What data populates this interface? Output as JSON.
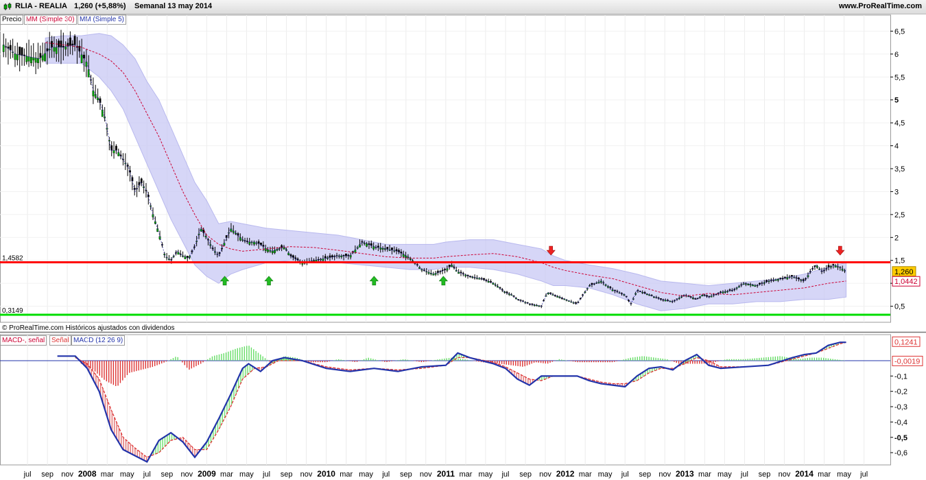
{
  "header": {
    "ticker": "RLIA - REALIA",
    "price_change": "1,260 (+5,88%)",
    "period": "Semanal  13 may 2014",
    "site": "www.ProRealTime.com"
  },
  "legend": {
    "price": "Precio",
    "ma30": "MM (Simple 30)",
    "ma5": "MM (Simple 5)",
    "macd_signal": "MACD-, señal",
    "signal": "Señal",
    "macd": "MACD (12 26 9)"
  },
  "footer_note": "© ProRealTime.com Históricos ajustados con dividendos",
  "colors": {
    "resistance": "#ff0000",
    "support": "#00dd00",
    "ma30": "#cc0033",
    "ma5": "#3333aa",
    "band": "#c8c8f4",
    "macd_line": "#2233aa",
    "hist_pos": "#66dd66",
    "hist_neg": "#dd3333",
    "arrow_up": "#22bb22",
    "arrow_down": "#ee2222"
  },
  "chart_data": [
    {
      "type": "line",
      "name": "price-panel",
      "ylim": [
        0.15,
        6.85
      ],
      "y_ticks": [
        "6,5",
        "6",
        "5,5",
        "5",
        "4,5",
        "4",
        "3,5",
        "3",
        "2,5",
        "2",
        "1,5",
        "1",
        "0,5"
      ],
      "y_tick_values": [
        6.5,
        6,
        5.5,
        5,
        4.5,
        4,
        3.5,
        3,
        2.5,
        2,
        1.5,
        1,
        0.5
      ],
      "x_months": [
        "jul",
        "sep",
        "nov",
        "2008",
        "mar",
        "may",
        "jul",
        "sep",
        "nov",
        "2009",
        "mar",
        "may",
        "jul",
        "sep",
        "nov",
        "2010",
        "mar",
        "may",
        "jul",
        "sep",
        "nov",
        "2011",
        "mar",
        "may",
        "jul",
        "sep",
        "nov",
        "2012",
        "mar",
        "may",
        "jul",
        "sep",
        "nov",
        "2013",
        "mar",
        "may",
        "jul",
        "sep",
        "nov",
        "2014",
        "mar",
        "may",
        "jul"
      ],
      "x_month_values": [
        2007.5,
        2007.667,
        2007.833,
        2008,
        2008.167,
        2008.333,
        2008.5,
        2008.667,
        2008.833,
        2009,
        2009.167,
        2009.333,
        2009.5,
        2009.667,
        2009.833,
        2010,
        2010.167,
        2010.333,
        2010.5,
        2010.667,
        2010.833,
        2011,
        2011.167,
        2011.333,
        2011.5,
        2011.667,
        2011.833,
        2012,
        2012.167,
        2012.333,
        2012.5,
        2012.667,
        2012.833,
        2013,
        2013.167,
        2013.333,
        2013.5,
        2013.667,
        2013.833,
        2014,
        2014.167,
        2014.333,
        2014.5
      ],
      "xlim": [
        2007.27,
        2014.72
      ],
      "price": {
        "x": [
          2007.3,
          2007.4,
          2007.5,
          2007.6,
          2007.7,
          2007.8,
          2007.9,
          2008.0,
          2008.05,
          2008.1,
          2008.15,
          2008.2,
          2008.25,
          2008.3,
          2008.35,
          2008.4,
          2008.45,
          2008.5,
          2008.55,
          2008.6,
          2008.65,
          2008.7,
          2008.75,
          2008.8,
          2008.85,
          2008.9,
          2008.95,
          2009.0,
          2009.05,
          2009.1,
          2009.15,
          2009.2,
          2009.3,
          2009.35,
          2009.4,
          2009.45,
          2009.5,
          2009.55,
          2009.6,
          2009.65,
          2009.7,
          2009.8,
          2009.9,
          2010.0,
          2010.1,
          2010.2,
          2010.3,
          2010.4,
          2010.5,
          2010.6,
          2010.7,
          2010.8,
          2010.9,
          2011.0,
          2011.05,
          2011.1,
          2011.2,
          2011.3,
          2011.4,
          2011.5,
          2011.55,
          2011.6,
          2011.7,
          2011.8,
          2011.85,
          2011.9,
          2012.0,
          2012.1,
          2012.2,
          2012.3,
          2012.4,
          2012.5,
          2012.55,
          2012.6,
          2012.7,
          2012.8,
          2012.9,
          2013.0,
          2013.05,
          2013.1,
          2013.15,
          2013.2,
          2013.25,
          2013.3,
          2013.4,
          2013.5,
          2013.6,
          2013.7,
          2013.8,
          2013.9,
          2014.0,
          2014.05,
          2014.1,
          2014.15,
          2014.2,
          2014.25,
          2014.3,
          2014.35
        ],
        "close": [
          6.2,
          6.0,
          5.95,
          5.9,
          6.15,
          6.15,
          6.2,
          5.8,
          5.2,
          5.0,
          4.6,
          3.9,
          3.9,
          3.7,
          3.5,
          3.0,
          3.2,
          3.0,
          2.5,
          2.1,
          1.6,
          1.5,
          1.7,
          1.6,
          1.55,
          1.8,
          2.2,
          2.0,
          1.75,
          1.6,
          1.9,
          2.2,
          1.95,
          1.9,
          1.9,
          1.85,
          1.75,
          1.7,
          1.75,
          1.8,
          1.6,
          1.45,
          1.5,
          1.55,
          1.6,
          1.6,
          1.9,
          1.8,
          1.75,
          1.7,
          1.55,
          1.3,
          1.2,
          1.3,
          1.4,
          1.25,
          1.15,
          1.1,
          1.0,
          0.8,
          0.75,
          0.65,
          0.55,
          0.5,
          0.8,
          0.75,
          0.65,
          0.55,
          0.95,
          1.05,
          0.85,
          0.75,
          0.55,
          0.85,
          0.75,
          0.65,
          0.6,
          0.75,
          0.7,
          0.65,
          0.75,
          0.7,
          0.75,
          0.8,
          0.85,
          1.0,
          0.95,
          1.05,
          1.1,
          1.15,
          1.05,
          1.25,
          1.4,
          1.25,
          1.35,
          1.4,
          1.35,
          1.26
        ]
      },
      "ma30": {
        "x": [
          2007.65,
          2007.8,
          2007.95,
          2008.1,
          2008.2,
          2008.3,
          2008.4,
          2008.5,
          2008.6,
          2008.7,
          2008.8,
          2008.9,
          2009.0,
          2009.1,
          2009.2,
          2009.3,
          2009.5,
          2009.7,
          2009.9,
          2010.1,
          2010.3,
          2010.5,
          2010.7,
          2010.9,
          2011.0,
          2011.2,
          2011.4,
          2011.6,
          2011.8,
          2011.9,
          2012.0,
          2012.2,
          2012.4,
          2012.6,
          2012.8,
          2013.0,
          2013.2,
          2013.4,
          2013.6,
          2013.8,
          2014.0,
          2014.2,
          2014.35
        ],
        "values": [
          6.25,
          6.2,
          6.15,
          6.0,
          5.85,
          5.6,
          5.2,
          4.7,
          4.2,
          3.6,
          3.0,
          2.5,
          2.05,
          1.85,
          1.75,
          1.7,
          1.75,
          1.8,
          1.78,
          1.72,
          1.65,
          1.58,
          1.55,
          1.55,
          1.58,
          1.62,
          1.65,
          1.58,
          1.45,
          1.35,
          1.28,
          1.18,
          1.1,
          0.95,
          0.8,
          0.72,
          0.78,
          0.75,
          0.8,
          0.85,
          0.9,
          1.0,
          1.05
        ]
      },
      "band_upper": [
        6.35,
        6.4,
        6.4,
        6.45,
        6.4,
        6.2,
        5.9,
        5.4,
        5.0,
        4.4,
        3.8,
        3.2,
        2.8,
        2.3,
        2.35,
        2.3,
        2.2,
        2.15,
        2.1,
        2.05,
        1.95,
        1.85,
        1.85,
        1.85,
        1.9,
        1.95,
        1.95,
        1.85,
        1.75,
        1.6,
        1.5,
        1.4,
        1.32,
        1.2,
        1.05,
        1.0,
        0.95,
        1.0,
        1.05,
        1.1,
        1.2,
        1.35,
        1.45
      ],
      "band_lower": [
        5.8,
        5.8,
        5.8,
        5.5,
        5.2,
        4.8,
        4.2,
        3.6,
        3.0,
        2.4,
        1.9,
        1.4,
        1.15,
        1.0,
        1.2,
        1.3,
        1.45,
        1.5,
        1.5,
        1.45,
        1.4,
        1.35,
        1.3,
        1.3,
        1.35,
        1.35,
        1.3,
        1.2,
        1.05,
        0.95,
        0.95,
        0.9,
        0.75,
        0.55,
        0.4,
        0.45,
        0.55,
        0.55,
        0.6,
        0.6,
        0.65,
        0.65,
        0.7
      ],
      "resistance_label": "1,4582",
      "resistance_value": 1.4582,
      "support_label": "0,3149",
      "support_value": 0.3149,
      "price_badge": "1,260",
      "ma30_badge": "1,0442",
      "arrows_up_x": [
        2009.15,
        2009.52,
        2010.4,
        2010.98
      ],
      "arrows_down_x": [
        2011.88,
        2014.3
      ]
    },
    {
      "type": "line",
      "name": "macd-panel",
      "ylim": [
        -0.68,
        0.17
      ],
      "y_ticks": [
        "-0,1",
        "-0,2",
        "-0,3",
        "-0,4",
        "-0,5",
        "-0,6"
      ],
      "y_tick_values": [
        -0.1,
        -0.2,
        -0.3,
        -0.4,
        -0.5,
        -0.6
      ],
      "macd_badge": "0,1241",
      "histogram_badge": "-0,0019",
      "macd": {
        "x": [
          2007.75,
          2007.9,
          2008.0,
          2008.1,
          2008.2,
          2008.3,
          2008.4,
          2008.5,
          2008.6,
          2008.7,
          2008.8,
          2008.9,
          2009.0,
          2009.1,
          2009.2,
          2009.3,
          2009.35,
          2009.45,
          2009.55,
          2009.65,
          2009.8,
          2010.0,
          2010.2,
          2010.4,
          2010.6,
          2010.8,
          2011.0,
          2011.1,
          2011.2,
          2011.4,
          2011.5,
          2011.6,
          2011.7,
          2011.8,
          2011.9,
          2012.1,
          2012.2,
          2012.3,
          2012.4,
          2012.5,
          2012.6,
          2012.7,
          2012.8,
          2012.9,
          2013.0,
          2013.1,
          2013.2,
          2013.3,
          2013.5,
          2013.7,
          2013.9,
          2014.0,
          2014.1,
          2014.2,
          2014.3,
          2014.35
        ],
        "values": [
          0.03,
          0.03,
          -0.05,
          -0.2,
          -0.45,
          -0.58,
          -0.62,
          -0.66,
          -0.52,
          -0.47,
          -0.53,
          -0.63,
          -0.53,
          -0.38,
          -0.22,
          -0.05,
          -0.02,
          -0.07,
          0.0,
          0.02,
          0.0,
          -0.05,
          -0.07,
          -0.05,
          -0.07,
          -0.04,
          -0.03,
          0.05,
          0.02,
          -0.02,
          -0.05,
          -0.12,
          -0.16,
          -0.1,
          -0.1,
          -0.1,
          -0.13,
          -0.15,
          -0.16,
          -0.17,
          -0.1,
          -0.05,
          -0.04,
          -0.06,
          0.0,
          0.04,
          -0.03,
          -0.05,
          -0.04,
          -0.03,
          0.02,
          0.04,
          0.05,
          0.1,
          0.12,
          0.12
        ]
      },
      "signal": {
        "x": [
          2007.9,
          2008.0,
          2008.1,
          2008.2,
          2008.3,
          2008.4,
          2008.5,
          2008.6,
          2008.7,
          2008.8,
          2008.9,
          2009.0,
          2009.1,
          2009.2,
          2009.3,
          2009.4,
          2009.5,
          2009.6,
          2009.8,
          2010.0,
          2010.2,
          2010.4,
          2010.6,
          2010.8,
          2011.0,
          2011.1,
          2011.2,
          2011.4,
          2011.5,
          2011.6,
          2011.7,
          2011.8,
          2011.9,
          2012.1,
          2012.2,
          2012.3,
          2012.4,
          2012.5,
          2012.6,
          2012.7,
          2012.8,
          2012.9,
          2013.0,
          2013.1,
          2013.2,
          2013.3,
          2013.5,
          2013.7,
          2013.9,
          2014.0,
          2014.1,
          2014.2,
          2014.3,
          2014.35
        ],
        "values": [
          0.02,
          -0.02,
          -0.12,
          -0.32,
          -0.5,
          -0.57,
          -0.63,
          -0.6,
          -0.52,
          -0.5,
          -0.58,
          -0.58,
          -0.45,
          -0.3,
          -0.12,
          -0.05,
          -0.04,
          0.0,
          0.0,
          -0.04,
          -0.06,
          -0.05,
          -0.06,
          -0.05,
          -0.03,
          0.02,
          0.02,
          -0.01,
          -0.04,
          -0.08,
          -0.12,
          -0.13,
          -0.1,
          -0.1,
          -0.12,
          -0.14,
          -0.15,
          -0.15,
          -0.13,
          -0.08,
          -0.05,
          -0.05,
          -0.02,
          0.02,
          0.0,
          -0.04,
          -0.04,
          -0.03,
          0.01,
          0.03,
          0.05,
          0.08,
          0.11,
          0.12
        ]
      },
      "histogram": {
        "x": [
          2007.95,
          2008.05,
          2008.15,
          2008.25,
          2008.35,
          2008.55,
          2008.65,
          2008.75,
          2008.85,
          2008.95,
          2009.05,
          2009.15,
          2009.25,
          2009.35,
          2009.45,
          2009.55,
          2009.65,
          2009.75,
          2009.85,
          2010.0,
          2010.1,
          2010.25,
          2010.35,
          2010.5,
          2010.65,
          2010.8,
          2010.95,
          2011.05,
          2011.15,
          2011.3,
          2011.45,
          2011.55,
          2011.65,
          2011.75,
          2011.85,
          2011.95,
          2012.1,
          2012.25,
          2012.4,
          2012.55,
          2012.65,
          2012.75,
          2012.85,
          2012.95,
          2013.05,
          2013.15,
          2013.25,
          2013.35,
          2013.5,
          2013.65,
          2013.8,
          2013.95,
          2014.05,
          2014.15,
          2014.25,
          2014.35
        ],
        "values": [
          -0.02,
          -0.06,
          -0.13,
          -0.17,
          -0.08,
          -0.04,
          -0.01,
          0.03,
          -0.06,
          -0.02,
          0.03,
          0.05,
          0.08,
          0.1,
          0.04,
          -0.02,
          0.03,
          0.02,
          -0.01,
          -0.01,
          0.01,
          -0.01,
          0.02,
          -0.01,
          0.01,
          -0.01,
          0.01,
          0.02,
          0.01,
          -0.01,
          -0.02,
          -0.03,
          -0.04,
          -0.01,
          -0.02,
          0.01,
          -0.01,
          -0.01,
          -0.01,
          0.02,
          0.03,
          0.02,
          0.01,
          -0.02,
          -0.02,
          -0.02,
          -0.01,
          0.01,
          0.01,
          0.02,
          0.03,
          0.01,
          0.02,
          0.02,
          0.01,
          0.0
        ]
      }
    }
  ]
}
